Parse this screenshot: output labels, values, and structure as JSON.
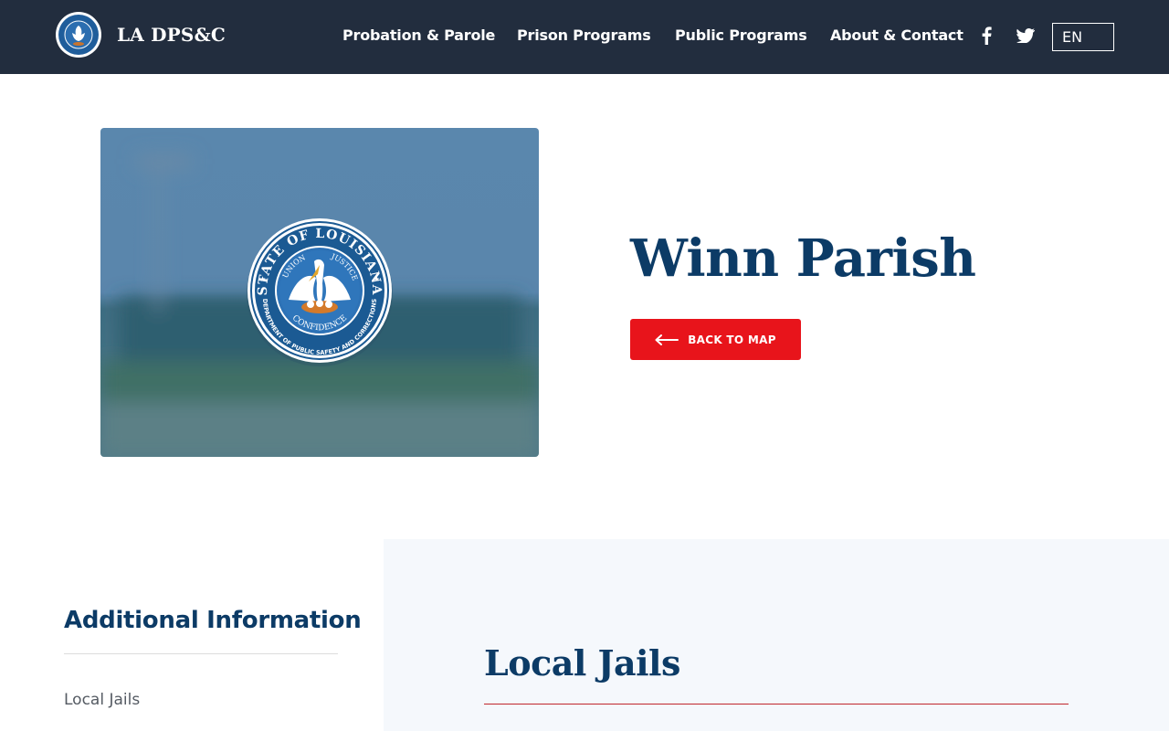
{
  "header": {
    "site_name": "LA DPS&C",
    "seal_text": "STATE OF LOUISIANA",
    "nav": [
      {
        "label": "Probation & Parole"
      },
      {
        "label": "Prison Programs"
      },
      {
        "label": "Public Programs"
      },
      {
        "label": "About & Contact"
      }
    ],
    "social": [
      "facebook-icon",
      "twitter-icon"
    ],
    "language": "EN"
  },
  "hero": {
    "title": "Winn Parish",
    "back_button": "BACK TO MAP",
    "seal": {
      "outer_text": "STATE OF LOUISIANA",
      "motto_left": "UNION",
      "motto_right": "JUSTICE",
      "motto_bottom": "CONFIDENCE",
      "ring_text": "DEPARTMENT OF PUBLIC SAFETY AND CORRECTIONS"
    }
  },
  "sidebar": {
    "title": "Additional Information",
    "links": [
      {
        "label": "Local Jails"
      }
    ]
  },
  "content": {
    "section_title": "Local Jails"
  },
  "colors": {
    "header_bg": "#222d3e",
    "title_blue": "#0c3b66",
    "button_red": "#e8141b",
    "panel_bg": "#f5f8fc"
  }
}
